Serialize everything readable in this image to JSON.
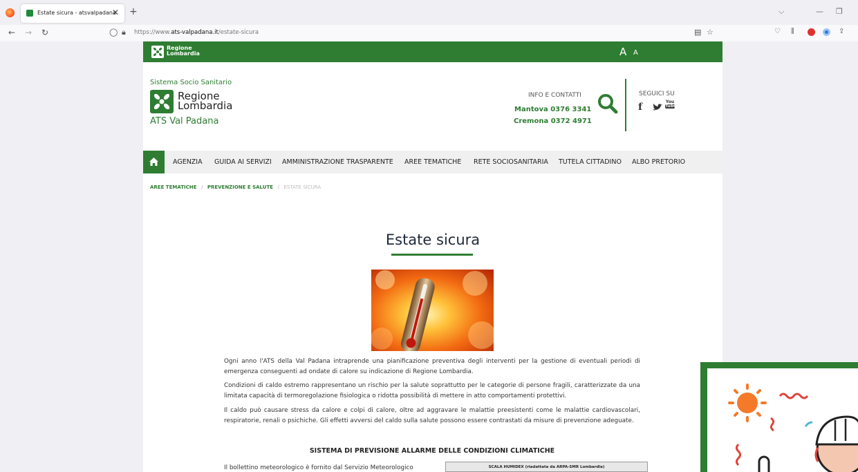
{
  "browser": {
    "tab_title": "Estate sicura - atsvalpadana",
    "tab_close": "✕",
    "new_tab": "+",
    "url_prefix": "https://www.",
    "url_domain": "ats-valpadana.it",
    "url_path": "/estate-sicura",
    "nav_back": "←",
    "nav_forward": "→",
    "nav_reload": "↻"
  },
  "site": {
    "strip_logo": "Regione Lombardia",
    "font_size_large": "A",
    "font_size_small": "A",
    "brand": {
      "system": "Sistema Socio Sanitario",
      "region_line1": "Regione",
      "region_line2": "Lombardia",
      "agency": "ATS Val Padana"
    },
    "contacts": {
      "label": "INFO E CONTATTI",
      "mantova": "Mantova 0376 3341",
      "cremona": "Cremona 0372 4971"
    },
    "social": {
      "label": "SEGUICI SU",
      "facebook": "f",
      "youtube_top": "You",
      "youtube_bottom": "Tube"
    },
    "menu": [
      "AGENZIA",
      "GUIDA AI SERVIZI",
      "AMMINISTRAZIONE TRASPARENTE",
      "AREE TEMATICHE",
      "RETE SOCIOSANITARIA",
      "TUTELA CITTADINO",
      "ALBO PRETORIO"
    ],
    "breadcrumb": [
      "AREE TEMATICHE",
      "PREVENZIONE E SALUTE",
      "ESTATE SICURA"
    ],
    "breadcrumb_sep": "/",
    "title": "Estate sicura",
    "paragraphs": [
      "Ogni anno l'ATS della Val Padana intraprende una pianificazione preventiva degli interventi per la gestione di eventuali periodi di emergenza conseguenti ad ondate di calore su indicazione di Regione Lombardia.",
      "Condizioni di caldo estremo rappresentano un rischio per la salute soprattutto per le categorie di persone fragili, caratterizzate da una limitata capacità di termoregolazione fisiologica o ridotta possibilità di mettere in atto comportamenti protettivi.",
      "Il caldo può causare stress da calore e colpi di calore, oltre ad aggravare le malattie preesistenti come le malattie cardiovascolari, respiratorie, renali o psichiche. Gli effetti avversi del caldo sulla salute possono essere contrastati da misure di prevenzione adeguate."
    ],
    "section_heading": "SISTEMA DI PREVISIONE ALLARME DELLE CONDIZIONI CLIMATICHE",
    "bulletin_text": "Il bollettino meteorologico è fornito dal Servizio Meteorologico",
    "humidex_caption": "SCALA HUMIDEX (riadattata da ARPA-SMR Lombardia)"
  },
  "colors": {
    "brand_green": "#2e7d32",
    "title_navy": "#1e2a3a"
  }
}
